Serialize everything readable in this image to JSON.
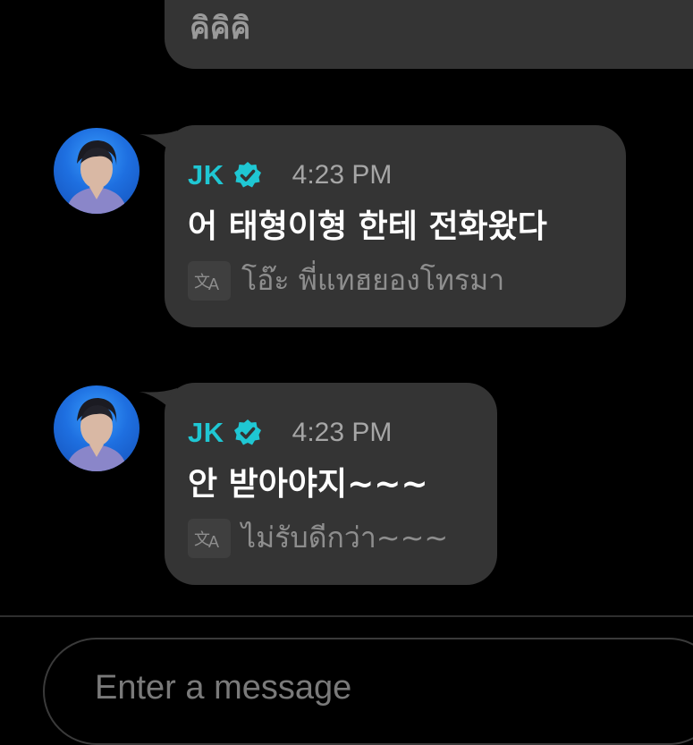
{
  "partial_message": {
    "text": "คิคิคิ"
  },
  "messages": [
    {
      "sender": "JK",
      "time": "4:23 PM",
      "text": "어 태형이형 한테 전화왔다",
      "translation": "โอ๊ะ พี่แทฮยองโทรมา"
    },
    {
      "sender": "JK",
      "time": "4:23 PM",
      "text": "안 받아야지~~~",
      "translation": "ไม่รับดีกว่า~~~"
    }
  ],
  "icons": {
    "verified": "verified-badge-icon",
    "translate": "translate-icon"
  },
  "colors": {
    "sender_name": "#1fc7d3",
    "bubble": "#343434",
    "background": "#000000"
  },
  "composer": {
    "placeholder": "Enter a message"
  }
}
